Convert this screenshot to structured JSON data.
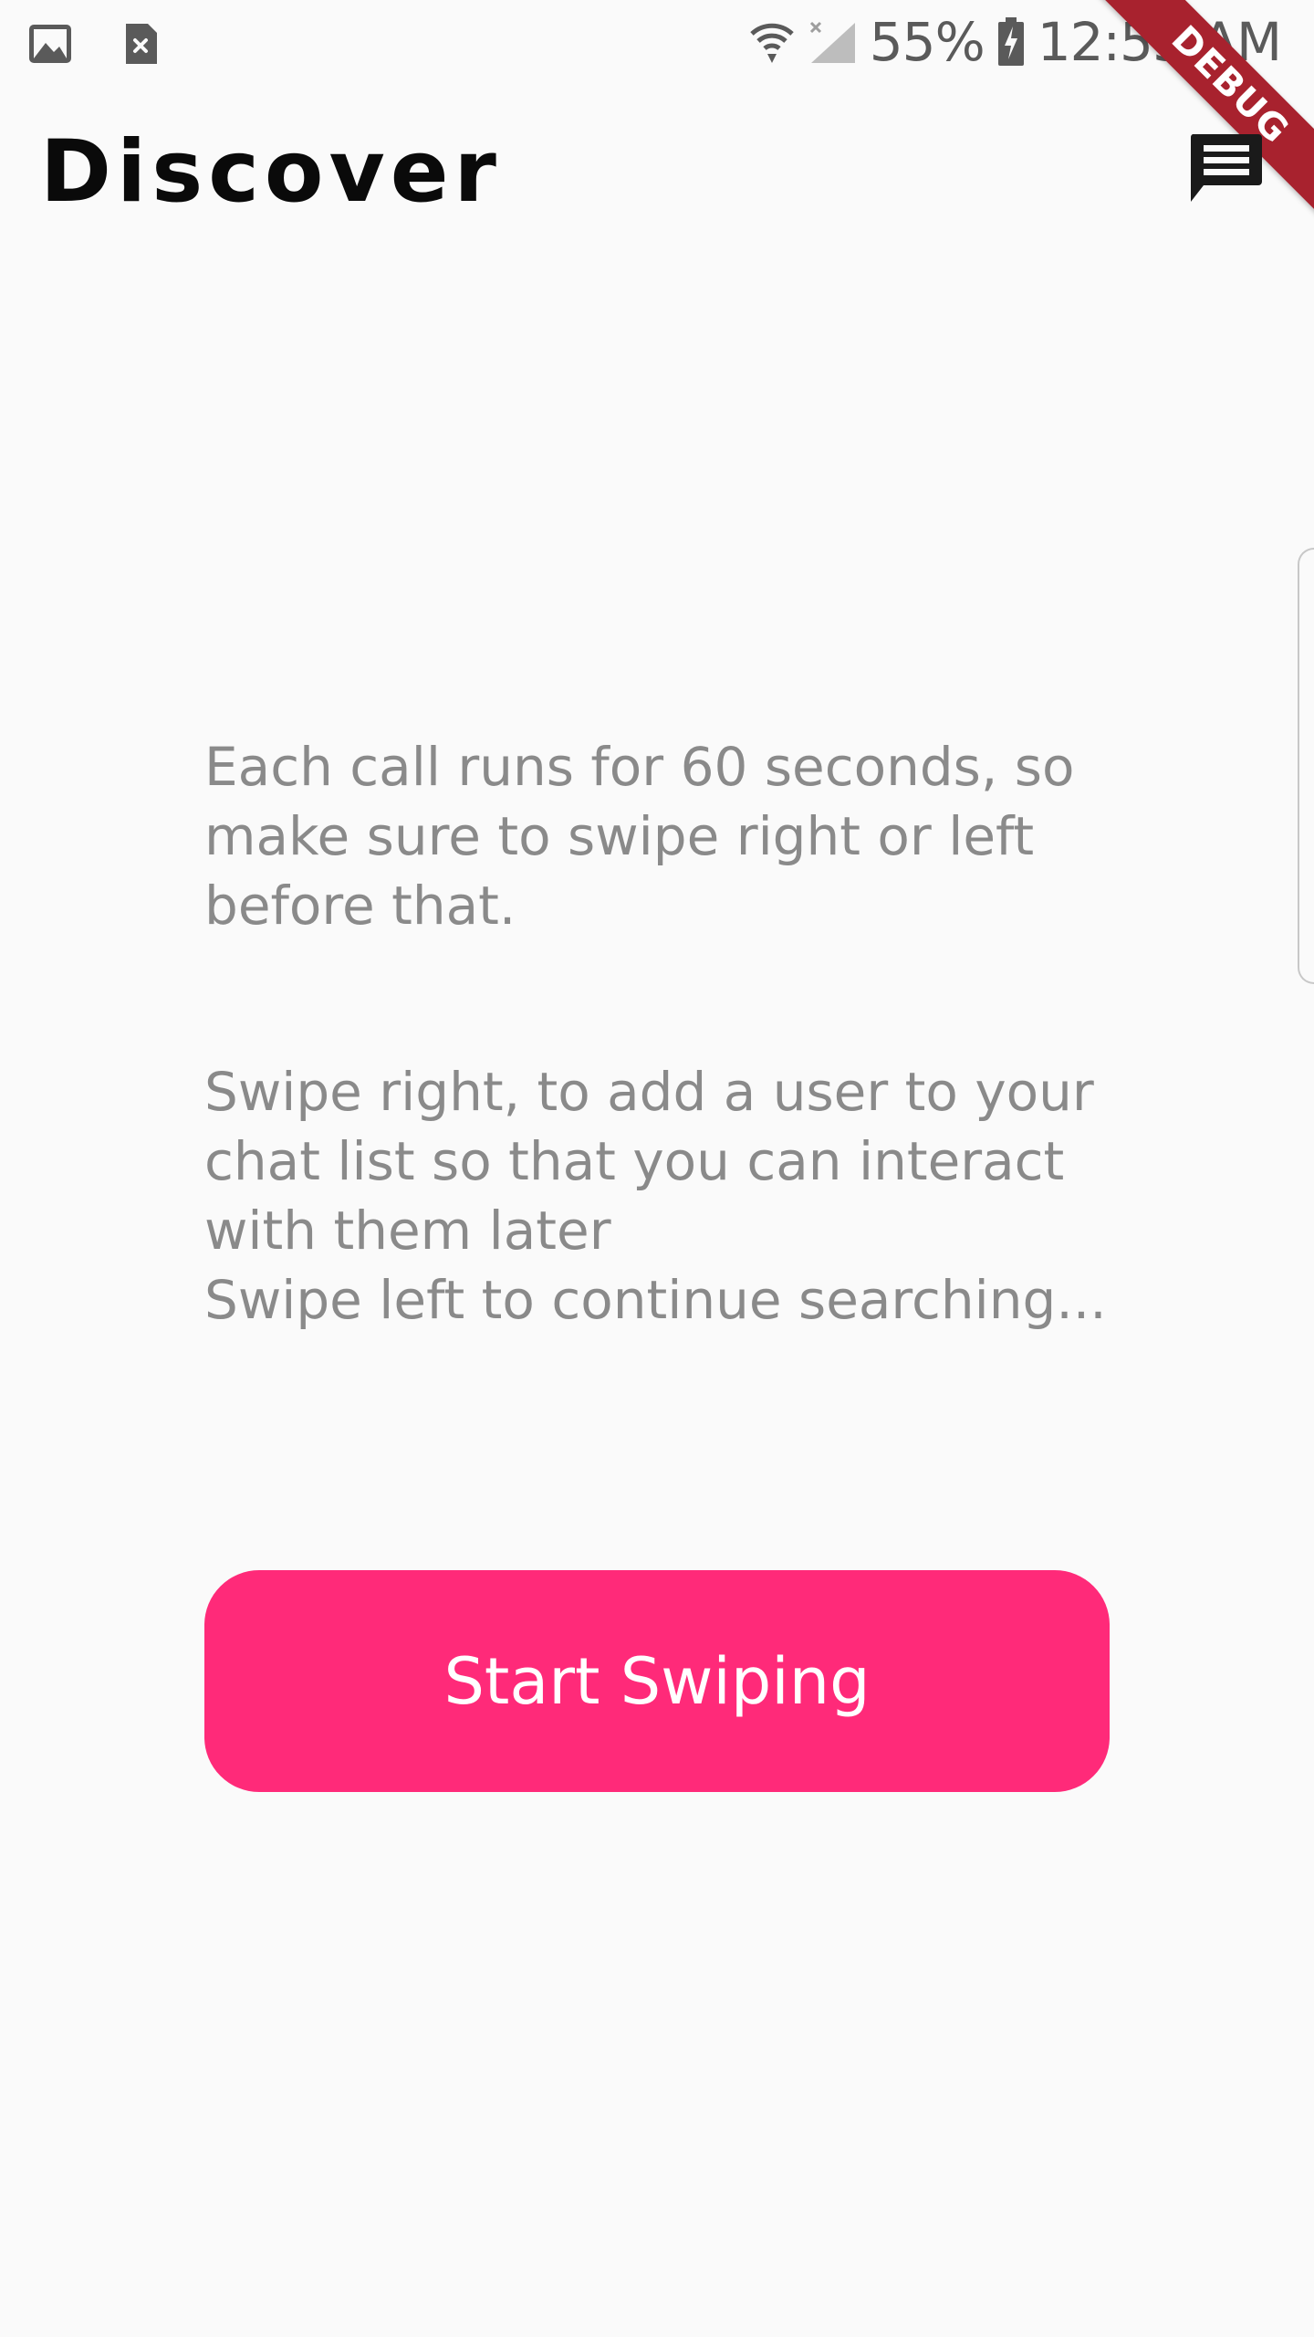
{
  "status_bar": {
    "battery": "55%",
    "time": "12:55 AM",
    "icons": [
      "image-icon",
      "file-close-icon",
      "wifi-icon",
      "signal-icon",
      "battery-charging-icon"
    ]
  },
  "debug_banner": {
    "label": "DEBUG",
    "color": "#a8222e"
  },
  "app_bar": {
    "title": "Discover",
    "action_icon": "chat-icon"
  },
  "main": {
    "instruction_1": "Each call runs for 60 seconds, so make sure to swipe right or left before that.",
    "instruction_2_lines": [
      "Swipe right, to add a user to your chat list so that you can interact with them later",
      "Swipe left to continue searching..."
    ],
    "start_button_label": "Start Swiping",
    "accent_color": "#ff2a79"
  }
}
